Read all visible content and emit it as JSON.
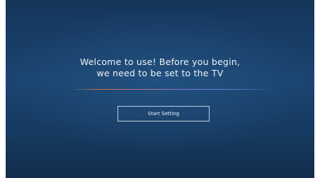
{
  "welcome": {
    "line1": "Welcome to use! Before you begin,",
    "line2": "we need to be set to the TV"
  },
  "actions": {
    "start_label": "Start Setting"
  }
}
